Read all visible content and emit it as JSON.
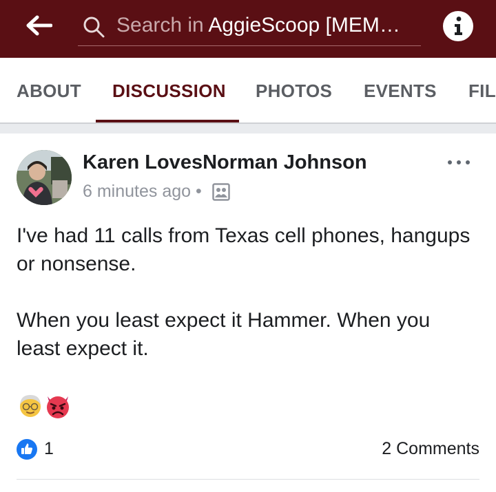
{
  "header": {
    "search_placeholder": "Search in ",
    "search_query": "AggieScoop [MEM…"
  },
  "tabs": [
    "ABOUT",
    "DISCUSSION",
    "PHOTOS",
    "EVENTS",
    "FIL"
  ],
  "post": {
    "author": "Karen LovesNorman Johnson",
    "time": "6 minutes ago",
    "separator": "•",
    "paragraphs": [
      "I've had 11 calls from Texas cell phones, hangups or nonsense.",
      "When you least expect it Hammer.  When you least expect it."
    ],
    "like_count": "1",
    "comments": "2 Comments"
  },
  "colors": {
    "brand": "#5a0f14",
    "like": "#1877f2",
    "muted": "#90949c"
  },
  "icons": [
    "back-arrow-icon",
    "search-icon",
    "info-icon",
    "more-options-icon",
    "group-icon",
    "old-man-emoji",
    "angry-devil-emoji",
    "like-icon"
  ]
}
